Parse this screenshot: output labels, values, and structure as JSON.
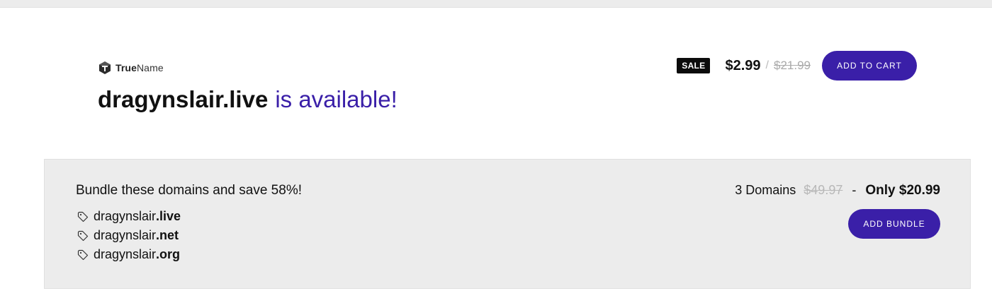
{
  "brand": {
    "name_bold": "True",
    "name_light": "Name"
  },
  "headline": {
    "domain": "dragynslair.live",
    "availability": "is available!"
  },
  "pricing": {
    "sale_badge": "SALE",
    "current_price": "$2.99",
    "separator": "/",
    "original_price": "$21.99",
    "add_to_cart_label": "ADD TO CART"
  },
  "bundle": {
    "title": "Bundle these domains and save 58%!",
    "domains": [
      {
        "name": "dragynslair",
        "tld": ".live"
      },
      {
        "name": "dragynslair",
        "tld": ".net"
      },
      {
        "name": "dragynslair",
        "tld": ".org"
      }
    ],
    "count_label": "3 Domains",
    "original_total": "$49.97",
    "dash": "-",
    "offer": "Only $20.99",
    "add_bundle_label": "ADD BUNDLE"
  },
  "colors": {
    "accent": "#3a1fa8",
    "badge_bg": "#0b0b0b",
    "bundle_bg": "#ececec"
  }
}
